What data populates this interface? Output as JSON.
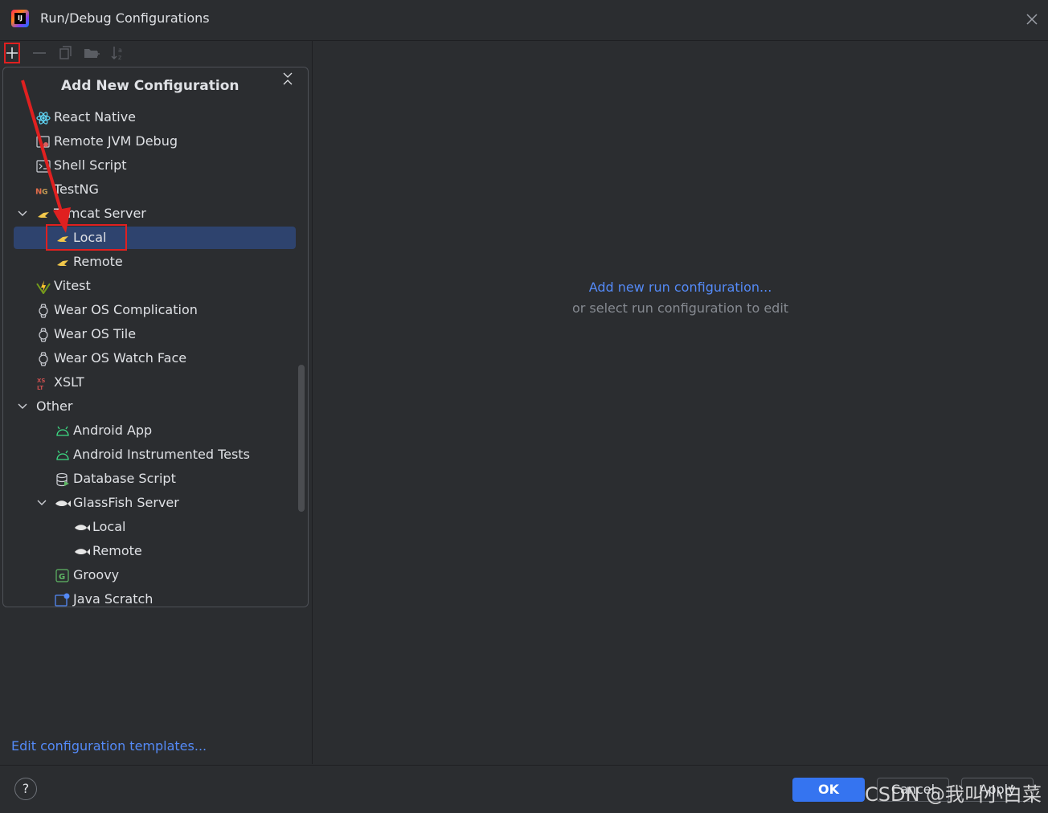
{
  "window": {
    "title": "Run/Debug Configurations"
  },
  "toolbar": {
    "add": "plus-icon",
    "remove": "minus-icon",
    "copy": "copy-icon",
    "folder": "new-folder-icon",
    "sort": "sort-icon"
  },
  "popup": {
    "title": "Add New Configuration",
    "items": [
      {
        "label": "React Native",
        "icon": "react-icon"
      },
      {
        "label": "Remote JVM Debug",
        "icon": "remote-debug-icon"
      },
      {
        "label": "Shell Script",
        "icon": "shell-icon"
      },
      {
        "label": "TestNG",
        "icon": "testng-icon"
      },
      {
        "label": "Tomcat Server",
        "icon": "tomcat-icon",
        "expanded": true
      },
      {
        "label": "Local",
        "icon": "tomcat-icon",
        "selected": true
      },
      {
        "label": "Remote",
        "icon": "tomcat-icon"
      },
      {
        "label": "Vitest",
        "icon": "vitest-icon"
      },
      {
        "label": "Wear OS Complication",
        "icon": "watch-icon"
      },
      {
        "label": "Wear OS Tile",
        "icon": "watch-icon"
      },
      {
        "label": "Wear OS Watch Face",
        "icon": "watch-icon"
      },
      {
        "label": "XSLT",
        "icon": "xslt-icon"
      },
      {
        "label": "Other",
        "expanded": true
      },
      {
        "label": "Android App",
        "icon": "android-icon"
      },
      {
        "label": "Android Instrumented Tests",
        "icon": "android-icon"
      },
      {
        "label": "Database Script",
        "icon": "database-icon"
      },
      {
        "label": "GlassFish Server",
        "icon": "glassfish-icon",
        "expanded": true
      },
      {
        "label": "Local",
        "icon": "glassfish-icon"
      },
      {
        "label": "Remote",
        "icon": "glassfish-icon"
      },
      {
        "label": "Groovy",
        "icon": "groovy-icon"
      },
      {
        "label": "Java Scratch",
        "icon": "java-scratch-icon"
      }
    ]
  },
  "left": {
    "edit_templates": "Edit configuration templates..."
  },
  "right": {
    "link": "Add new run configuration...",
    "hint": "or select run configuration to edit"
  },
  "buttons": {
    "help": "?",
    "ok": "OK",
    "cancel": "Cancel",
    "apply": "Apply"
  },
  "watermark": "CSDN @我叫小白菜",
  "colors": {
    "accent": "#3574f0",
    "link": "#548af7",
    "selection": "#2e436e",
    "annotation": "#e02020"
  }
}
